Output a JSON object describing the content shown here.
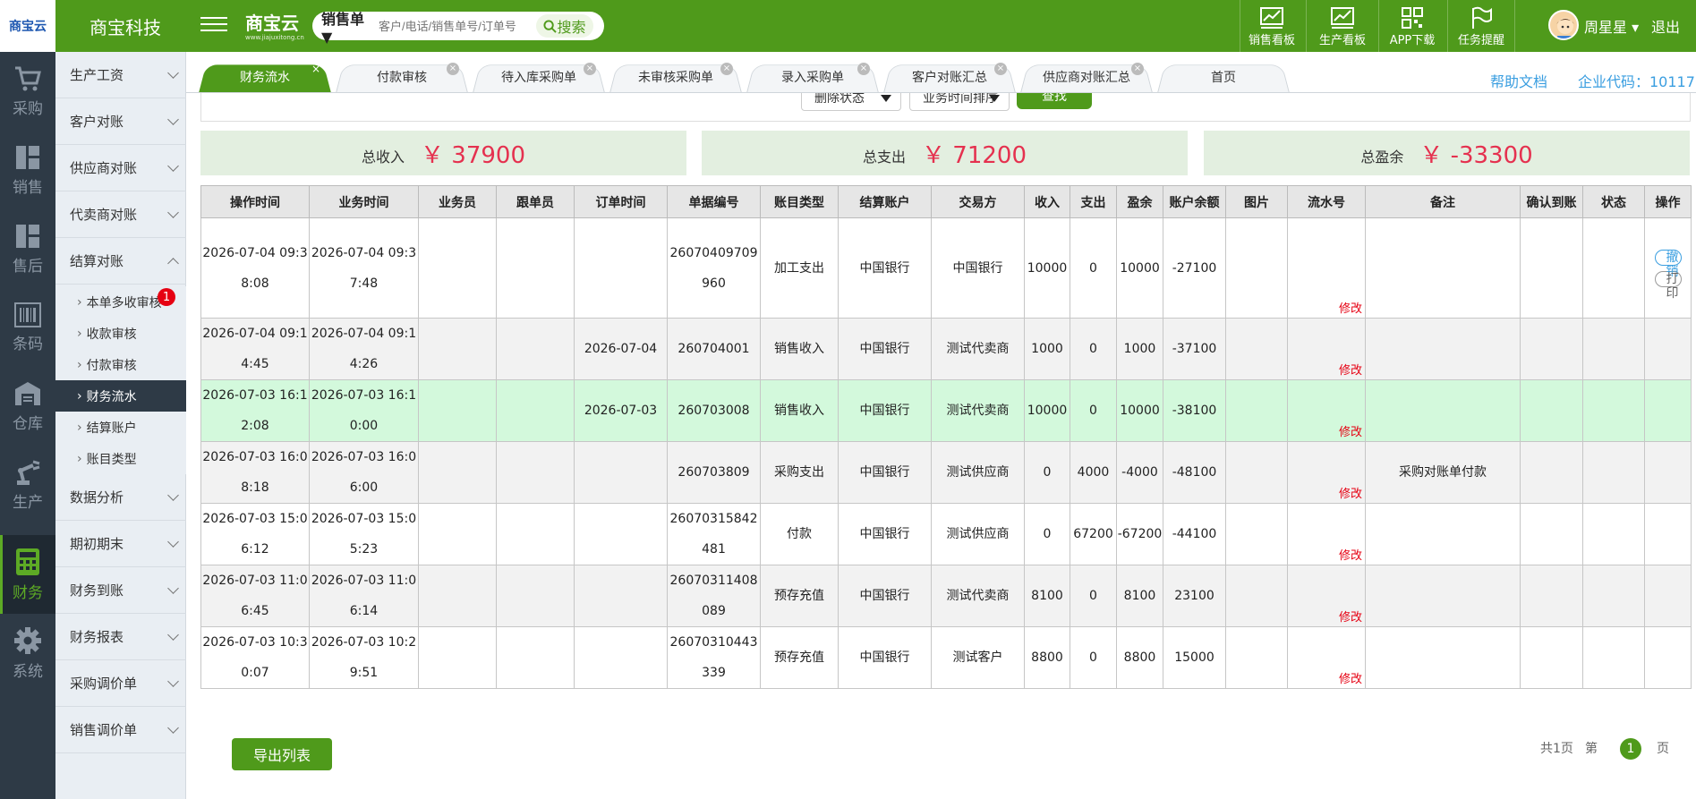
{
  "header": {
    "logo_text": "商宝云",
    "company": "商宝科技",
    "brand_name": "商宝云",
    "brand_url": "www.jiajuxitong.cn",
    "search": {
      "type_label": "销售单 ▼",
      "placeholder": "客户/电话/销售单号/订单号",
      "button": "搜索"
    },
    "nav": [
      {
        "label": "销售看板",
        "icon": "chart-board-icon"
      },
      {
        "label": "生产看板",
        "icon": "chart-board-icon"
      },
      {
        "label": "APP下载",
        "icon": "qrcode-icon"
      },
      {
        "label": "任务提醒",
        "icon": "flag-icon"
      }
    ],
    "user_name": "周星星 ▾",
    "logout": "退出"
  },
  "rail": [
    {
      "label": "采购",
      "icon": "cart-icon"
    },
    {
      "label": "销售",
      "icon": "building-icon"
    },
    {
      "label": "售后",
      "icon": "building-icon"
    },
    {
      "label": "条码",
      "icon": "barcode-icon"
    },
    {
      "label": "仓库",
      "icon": "warehouse-icon"
    },
    {
      "label": "生产",
      "icon": "robot-arm-icon"
    },
    {
      "label": "财务",
      "icon": "calculator-icon",
      "active": true
    },
    {
      "label": "系统",
      "icon": "gear-icon"
    }
  ],
  "submenu": {
    "items": [
      "生产工资",
      "客户对账",
      "供应商对账",
      "代卖商对账",
      "结算对账",
      "数据分析",
      "期初期末",
      "财务到账",
      "财务报表",
      "采购调价单",
      "销售调价单"
    ],
    "sub_items": [
      "本单多收审核",
      "收款审核",
      "付款审核",
      "财务流水",
      "结算账户",
      "账目类型"
    ],
    "badge": "1"
  },
  "tabs": [
    "财务流水",
    "付款审核",
    "待入库采购单",
    "未审核采购单",
    "录入采购单",
    "客户对账汇总",
    "供应商对账汇总",
    "首页"
  ],
  "help": "帮助文档",
  "corp_code": "企业代码：10117",
  "filters": {
    "delete_status": "删除状态",
    "sort": "业务时间排序",
    "query": "查找"
  },
  "summary": [
    {
      "label": "总收入",
      "value": "￥ 37900"
    },
    {
      "label": "总支出",
      "value": "￥ 71200"
    },
    {
      "label": "总盈余",
      "value": "￥ -33300"
    }
  ],
  "table": {
    "columns": [
      "操作时间",
      "业务时间",
      "业务员",
      "跟单员",
      "订单时间",
      "单据编号",
      "账目类型",
      "结算账户",
      "交易方",
      "收入",
      "支出",
      "盈余",
      "账户余额",
      "图片",
      "流水号",
      "备注",
      "确认到账",
      "状态",
      "操作"
    ],
    "edit_label": "修改",
    "undo_label": "撤销",
    "print_label": "打印",
    "rows": [
      {
        "op_time": "2026-07-04 09:38:08",
        "biz_time": "2026-07-04 09:37:48",
        "order_time": "",
        "doc_no": "26070409709960",
        "type": "加工支出",
        "account": "中国银行",
        "party": "中国银行",
        "income": "10000",
        "expense": "0",
        "surplus": "10000",
        "balance": "-27100",
        "remark": ""
      },
      {
        "op_time": "2026-07-04 09:14:45",
        "biz_time": "2026-07-04 09:14:26",
        "order_time": "2026-07-04",
        "doc_no": "260704001",
        "type": "销售收入",
        "account": "中国银行",
        "party": "测试代卖商",
        "income": "1000",
        "expense": "0",
        "surplus": "1000",
        "balance": "-37100",
        "remark": ""
      },
      {
        "op_time": "2026-07-03 16:12:08",
        "biz_time": "2026-07-03 16:10:00",
        "order_time": "2026-07-03",
        "doc_no": "260703008",
        "type": "销售收入",
        "account": "中国银行",
        "party": "测试代卖商",
        "income": "10000",
        "expense": "0",
        "surplus": "10000",
        "balance": "-38100",
        "remark": ""
      },
      {
        "op_time": "2026-07-03 16:08:18",
        "biz_time": "2026-07-03 16:06:00",
        "order_time": "",
        "doc_no": "260703809",
        "type": "采购支出",
        "account": "中国银行",
        "party": "测试供应商",
        "income": "0",
        "expense": "4000",
        "surplus": "-4000",
        "balance": "-48100",
        "remark": "采购对账单付款"
      },
      {
        "op_time": "2026-07-03 15:06:12",
        "biz_time": "2026-07-03 15:05:23",
        "order_time": "",
        "doc_no": "26070315842481",
        "type": "付款",
        "account": "中国银行",
        "party": "测试供应商",
        "income": "0",
        "expense": "67200",
        "surplus": "-67200",
        "balance": "-44100",
        "remark": ""
      },
      {
        "op_time": "2026-07-03 11:06:45",
        "biz_time": "2026-07-03 11:06:14",
        "order_time": "",
        "doc_no": "26070311408089",
        "type": "预存充值",
        "account": "中国银行",
        "party": "测试代卖商",
        "income": "8100",
        "expense": "0",
        "surplus": "8100",
        "balance": "23100",
        "remark": ""
      },
      {
        "op_time": "2026-07-03 10:30:07",
        "biz_time": "2026-07-03 10:29:51",
        "order_time": "",
        "doc_no": "26070310443339",
        "type": "预存充值",
        "account": "中国银行",
        "party": "测试客户",
        "income": "8800",
        "expense": "0",
        "surplus": "8800",
        "balance": "15000",
        "remark": ""
      }
    ]
  },
  "footer": {
    "export": "导出列表",
    "total_pages": "共1页",
    "page_prefix": "第",
    "current_page": "1",
    "page_suffix": "页"
  },
  "colors": {
    "brand": "#4f9a1b",
    "rail": "#2e3a46",
    "amount": "#e5314f",
    "link": "#3a9ee0",
    "highlight_row": "#d3f9dc"
  }
}
